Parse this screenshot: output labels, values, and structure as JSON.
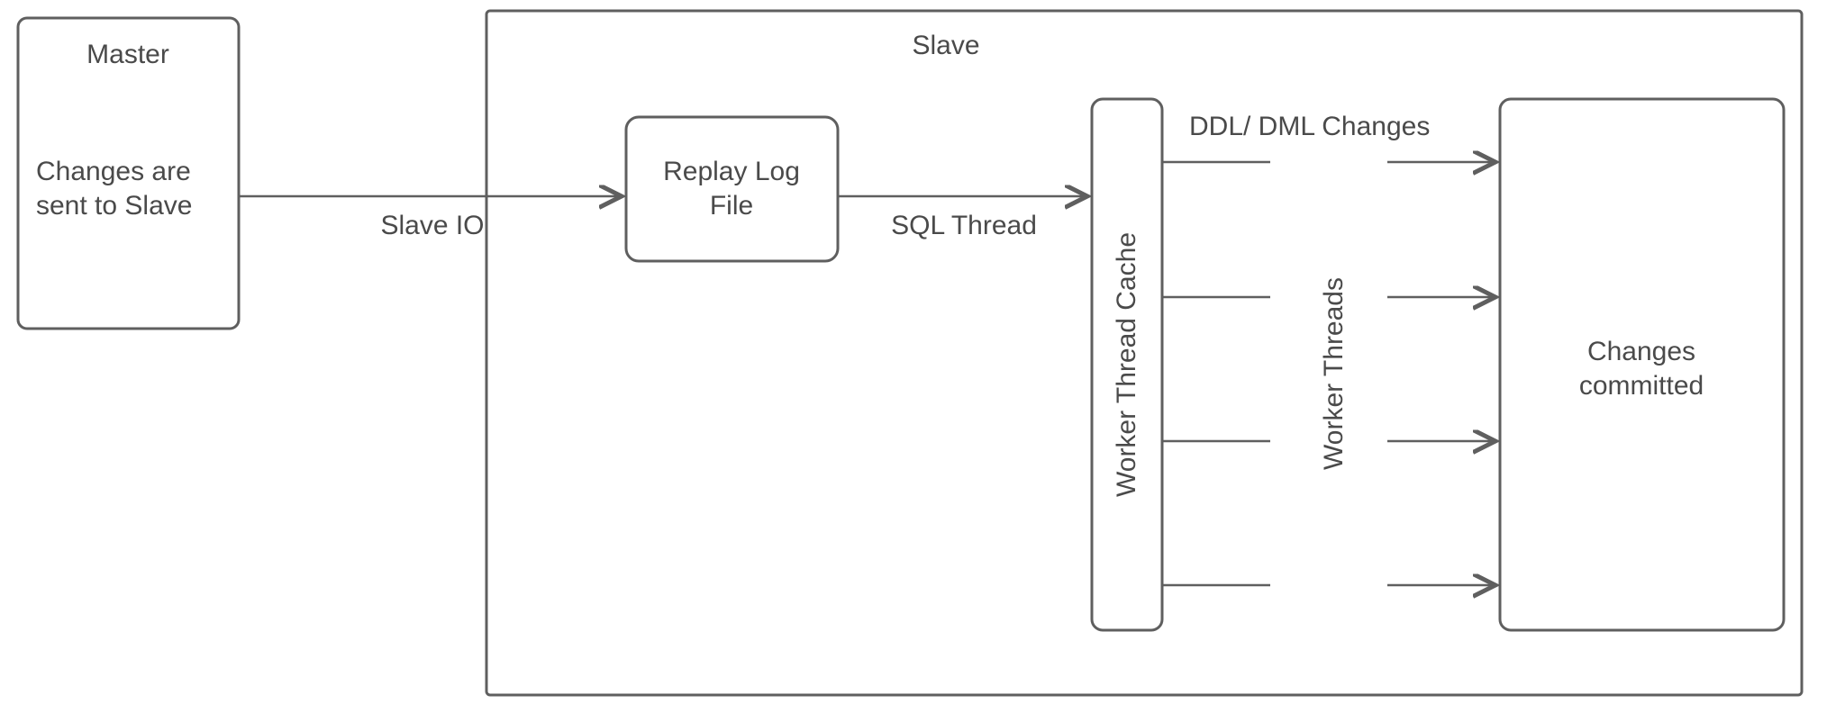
{
  "master": {
    "title": "Master",
    "desc_line1": "Changes are",
    "desc_line2": "sent to Slave"
  },
  "slave": {
    "title": "Slave",
    "replay_box_line1": "Replay Log",
    "replay_box_line2": "File",
    "worker_cache_label": "Worker Thread Cache",
    "committed_line1": "Changes",
    "committed_line2": "committed"
  },
  "arrows": {
    "slave_io": "Slave IO",
    "sql_thread": "SQL Thread",
    "ddl_dml": "DDL/ DML Changes",
    "worker_threads": "Worker Threads"
  }
}
